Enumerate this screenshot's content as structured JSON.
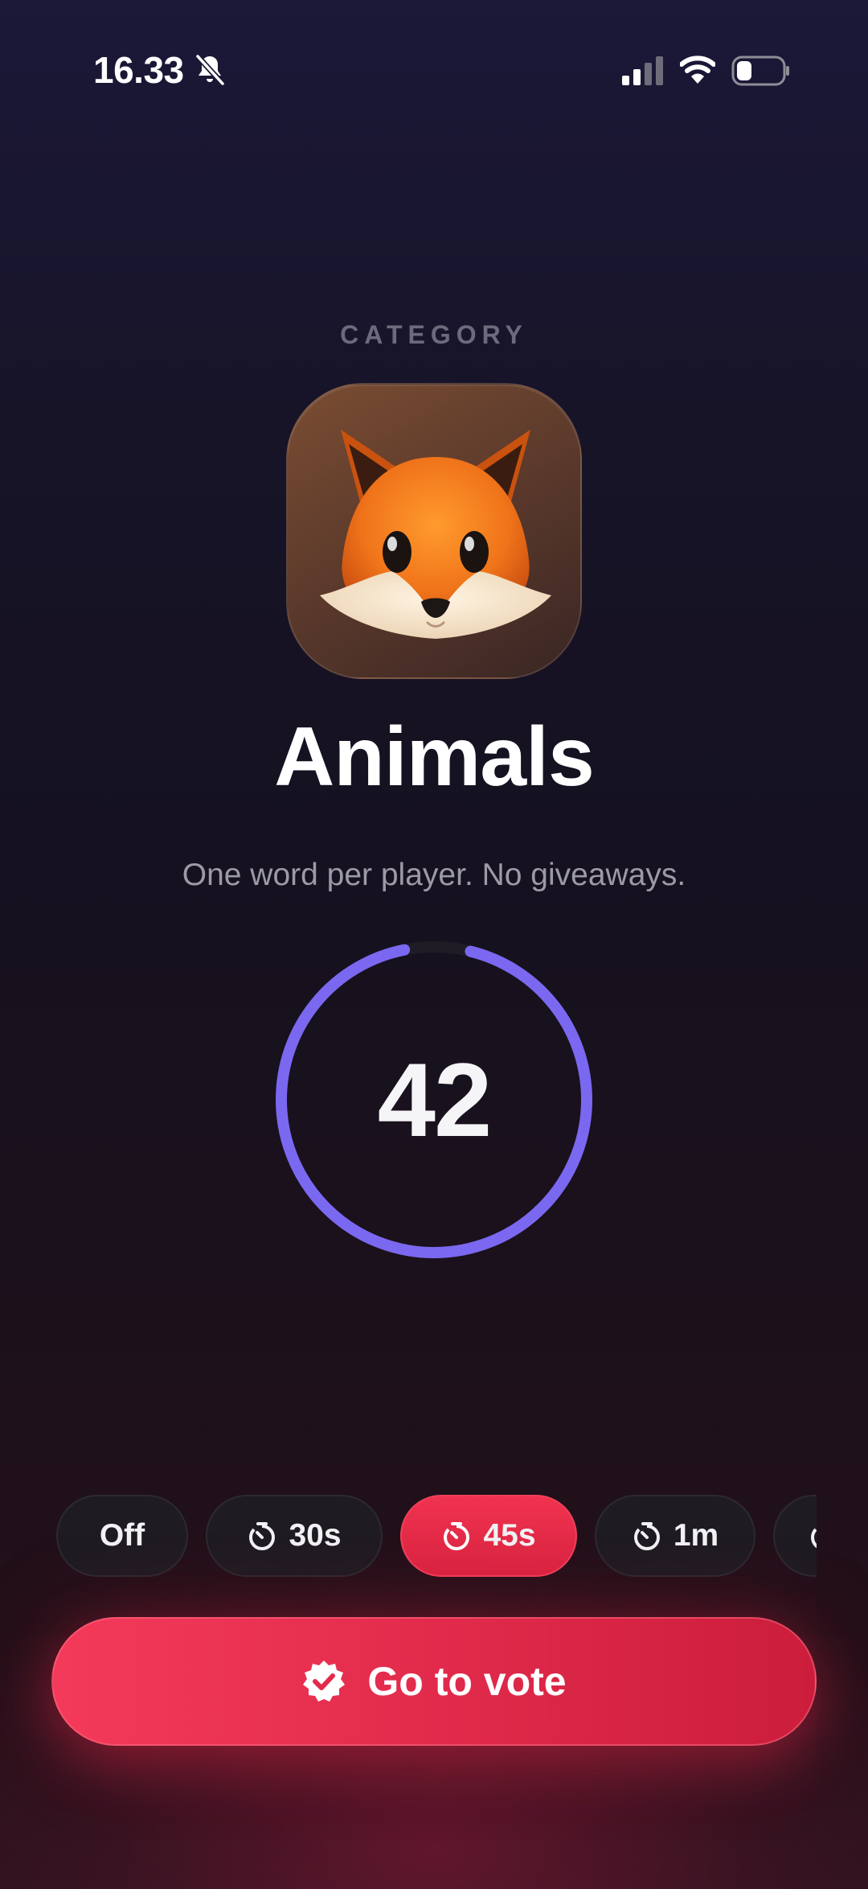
{
  "status_bar": {
    "time": "16.33",
    "icons": [
      "bell-muted-icon",
      "cellular-signal-icon",
      "wifi-icon",
      "battery-icon"
    ]
  },
  "category": {
    "label": "CATEGORY",
    "icon": "fox-emoji",
    "title": "Animals",
    "subtitle": "One word per player. No giveaways."
  },
  "timer": {
    "value": "42",
    "remaining_fraction": 0.93,
    "ring_color": "#7b68f0"
  },
  "timer_options": [
    {
      "label": "Off",
      "icon": "",
      "selected": false
    },
    {
      "label": "30s",
      "icon": "stopwatch-icon",
      "selected": false
    },
    {
      "label": "45s",
      "icon": "stopwatch-icon",
      "selected": true
    },
    {
      "label": "1m",
      "icon": "stopwatch-icon",
      "selected": false
    },
    {
      "label": "",
      "icon": "stopwatch-icon",
      "selected": false
    }
  ],
  "vote_button": {
    "label": "Go to vote",
    "icon": "verified-check-icon"
  },
  "colors": {
    "accent": "#e5304d",
    "ring": "#7b68f0",
    "background_top": "#1b1838",
    "background_bottom": "#2e1320"
  }
}
